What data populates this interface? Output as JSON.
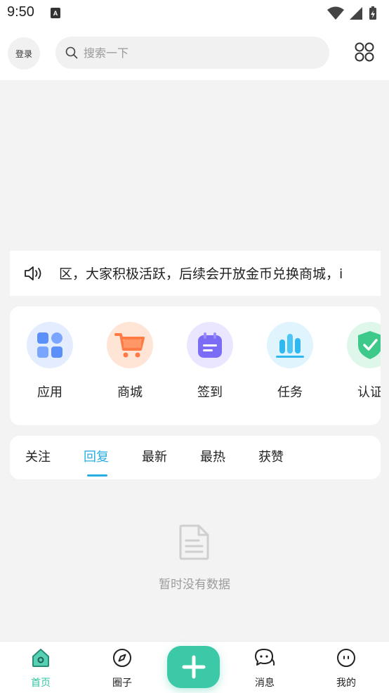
{
  "status_bar": {
    "time": "9:50",
    "notification_icon": "A"
  },
  "header": {
    "login_label": "登录",
    "search_placeholder": "搜索一下"
  },
  "notice": {
    "text": "区，大家积极活跃，后续会开放金币兑换商城，i"
  },
  "apps": [
    {
      "label": "应用",
      "icon": "apps-icon",
      "color": "#5b8ff9"
    },
    {
      "label": "商城",
      "icon": "cart-icon",
      "color": "#ff7a45"
    },
    {
      "label": "签到",
      "icon": "calendar-icon",
      "color": "#7b6cf6"
    },
    {
      "label": "任务",
      "icon": "bar-chart-icon",
      "color": "#2fb8f0"
    },
    {
      "label": "认证",
      "icon": "shield-check-icon",
      "color": "#3cc98a"
    }
  ],
  "tabs": [
    {
      "label": "关注",
      "active": false
    },
    {
      "label": "回复",
      "active": true
    },
    {
      "label": "最新",
      "active": false
    },
    {
      "label": "最热",
      "active": false
    },
    {
      "label": "获赞",
      "active": false
    }
  ],
  "empty_state": {
    "text": "暂时没有数据"
  },
  "bottom_nav": [
    {
      "label": "首页",
      "icon": "home-icon",
      "active": true
    },
    {
      "label": "圈子",
      "icon": "compass-icon",
      "active": false
    },
    {
      "label": "消息",
      "icon": "chat-icon",
      "active": false
    },
    {
      "label": "我的",
      "icon": "profile-face-icon",
      "active": false
    }
  ],
  "colors": {
    "accent_blue": "#28aee0",
    "accent_green": "#3cc9a8",
    "background": "#f3f3f4"
  }
}
